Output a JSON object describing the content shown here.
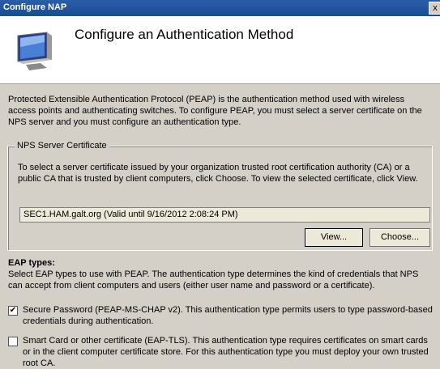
{
  "window": {
    "title": "Configure NAP",
    "close_glyph": "x"
  },
  "header": {
    "title": "Configure an Authentication Method",
    "icon": "monitor-icon"
  },
  "intro": "Protected Extensible Authentication Protocol (PEAP) is the authentication method used with wireless access points and authenticating switches. To configure PEAP, you must select a server certificate on the NPS server and you must configure an authentication type.",
  "nps": {
    "legend": "NPS Server Certificate",
    "description": "To select a server certificate issued by your organization trusted root certification authority (CA) or a public CA that is trusted by client computers, click Choose. To view the selected certificate, click View.",
    "certificate_value": "SEC1.HAM.galt.org (Valid until 9/16/2012 2:08:24 PM)",
    "view_label": "View...",
    "choose_label": "Choose..."
  },
  "eap": {
    "heading": "EAP types:",
    "description": "Select EAP types to use with PEAP. The authentication type determines the kind of credentials that NPS can accept from client computers and users (either user name and password or a certificate).",
    "options": [
      {
        "label": "Secure Password (PEAP-MS-CHAP v2). This authentication type permits users to type password-based credentials during authentication.",
        "checked": true
      },
      {
        "label": "Smart Card or other certificate (EAP-TLS). This authentication type requires certificates on smart cards or in the client computer certificate store. For this authentication type you must deploy your own trusted root CA.",
        "checked": false
      }
    ]
  }
}
